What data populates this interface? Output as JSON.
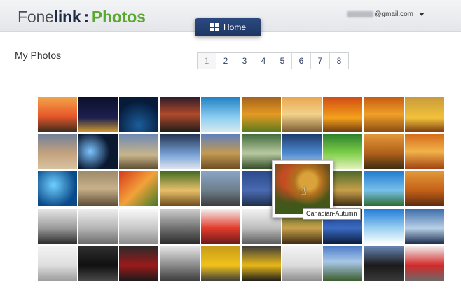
{
  "header": {
    "logo_fone": "Fone",
    "logo_link": "link",
    "logo_sep": ":",
    "logo_photos": "Photos",
    "account_email": "@gmail.com"
  },
  "nav": {
    "home_label": "Home"
  },
  "page": {
    "title": "My Photos"
  },
  "pagination": {
    "pages": [
      "1",
      "2",
      "3",
      "4",
      "5",
      "6",
      "7",
      "8"
    ],
    "active": "1"
  },
  "gallery": {
    "rows": 5,
    "cols": 10,
    "hover_photo": {
      "tooltip": "Canadian-Autumn"
    }
  }
}
